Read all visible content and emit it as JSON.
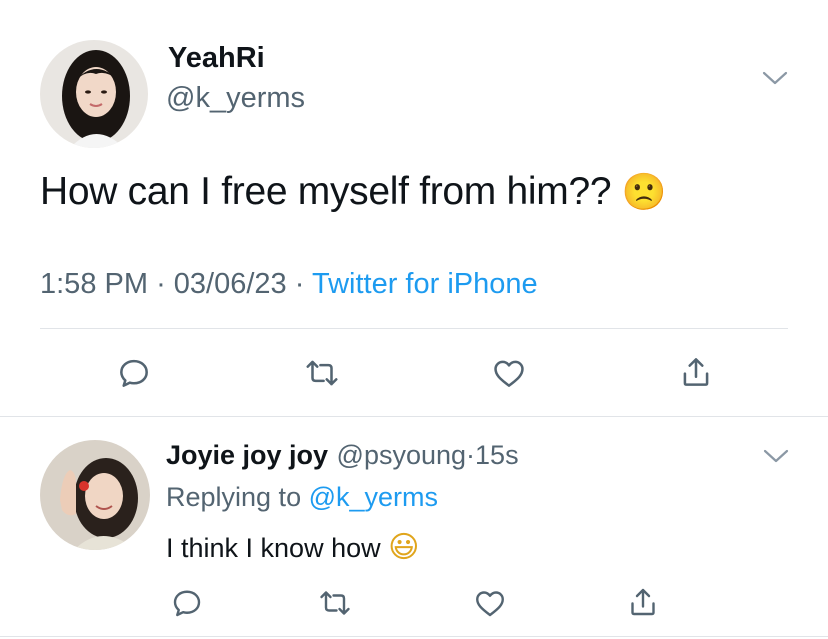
{
  "tweet": {
    "author_name": "YeahRi",
    "author_handle": "@k_yerms",
    "text": "How can I free myself from him??",
    "emoji": "🙁",
    "time": "1:58 PM",
    "sep1": "·",
    "date": "03/06/23",
    "sep2": "·",
    "source": "Twitter for iPhone"
  },
  "reply": {
    "author_name": "Joyie joy joy",
    "author_handle": "@psyoung",
    "sep": "·",
    "age": "15s",
    "replying_prefix": "Replying to",
    "replying_handle": "@k_yerms",
    "text": "I think I know how",
    "emoji": "😃"
  },
  "icons": {
    "more": "chevron-down-icon",
    "actions": [
      "reply-icon",
      "retweet-icon",
      "like-icon",
      "share-icon"
    ]
  },
  "colors": {
    "link": "#1d9bf0",
    "muted": "#536471",
    "text": "#0f1419",
    "divider": "#e1e4e8"
  }
}
